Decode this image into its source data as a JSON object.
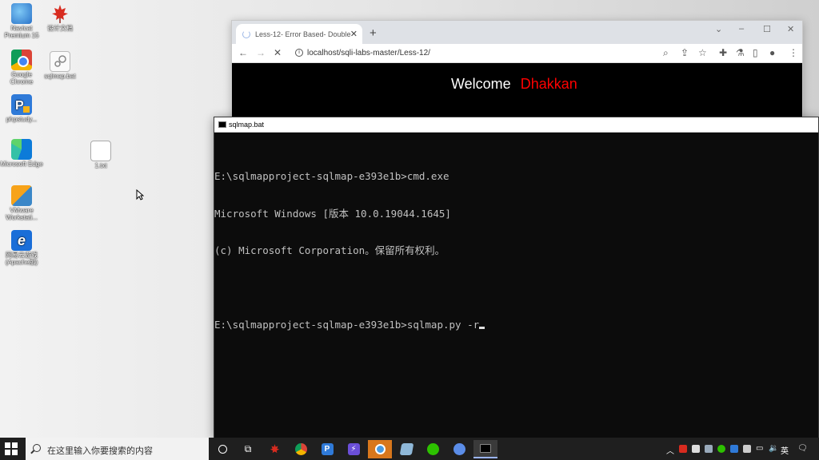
{
  "desktop": {
    "icons": [
      {
        "label": "Navicat Premium 15",
        "icon": "navicat-icon"
      },
      {
        "label": "设计文档",
        "icon": "maple-leaf-icon"
      },
      {
        "label": "Google Chrome",
        "icon": "chrome-icon"
      },
      {
        "label": "sqlmap.bat",
        "icon": "batch-file-icon"
      },
      {
        "label": "phpstudy...",
        "icon": "phpstudy-icon"
      },
      {
        "label": "Microsoft Edge",
        "icon": "edge-icon"
      },
      {
        "label": "1.txt",
        "icon": "text-file-icon"
      },
      {
        "label": "VMware Workstati...",
        "icon": "vmware-icon"
      },
      {
        "label": "网易云游戏 (Apache版)",
        "icon": "ie-icon"
      }
    ]
  },
  "browser": {
    "tab_title": "Less-12- Error Based- Double",
    "tab_close": "✕",
    "new_tab": "+",
    "url": "localhost/sqli-labs-master/Less-12/",
    "page": {
      "welcome": "Welcome",
      "name": "Dhakkan"
    }
  },
  "cmd": {
    "title": "sqlmap.bat",
    "lines": [
      "E:\\sqlmapproject-sqlmap-e393e1b>cmd.exe",
      "Microsoft Windows [版本 10.0.19044.1645]",
      "(c) Microsoft Corporation。保留所有权利。",
      "",
      "E:\\sqlmapproject-sqlmap-e393e1b>sqlmap.py -r"
    ]
  },
  "taskbar": {
    "search_placeholder": "在这里输入你要搜索的内容",
    "ime": "英",
    "colors": {
      "bg": "#1f1f1f",
      "accent": "#9ab4ff"
    }
  }
}
